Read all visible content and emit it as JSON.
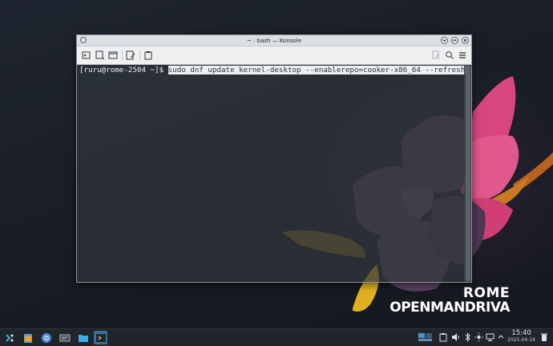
{
  "window": {
    "title": "~ : bash — Konsole"
  },
  "terminal": {
    "prompt": "[ruru@rome-2504 ~]$ ",
    "command": "sudo dnf update kernel-desktop --enablerepo=cooker-x86_64 --refresh "
  },
  "wallpaper": {
    "brand_top": "ROME",
    "brand_bottom": "OPENMANDRIVA"
  },
  "taskbar": {
    "time": "15:40",
    "date": "2025-04-14",
    "apps": [
      "app-launcher-icon",
      "file-manager-icon",
      "browser-icon",
      "system-settings-icon",
      "folder-icon",
      "konsole-icon"
    ],
    "tray": [
      "task-switcher-icon",
      "clipboard-icon",
      "volume-icon",
      "bluetooth-icon",
      "brightness-icon",
      "display-icon",
      "expand-tray-icon",
      "trash-icon"
    ]
  },
  "colors": {
    "accent": "#3a6f8f",
    "terminal_bg": "#31363b",
    "panel_bg": "#20242b"
  }
}
